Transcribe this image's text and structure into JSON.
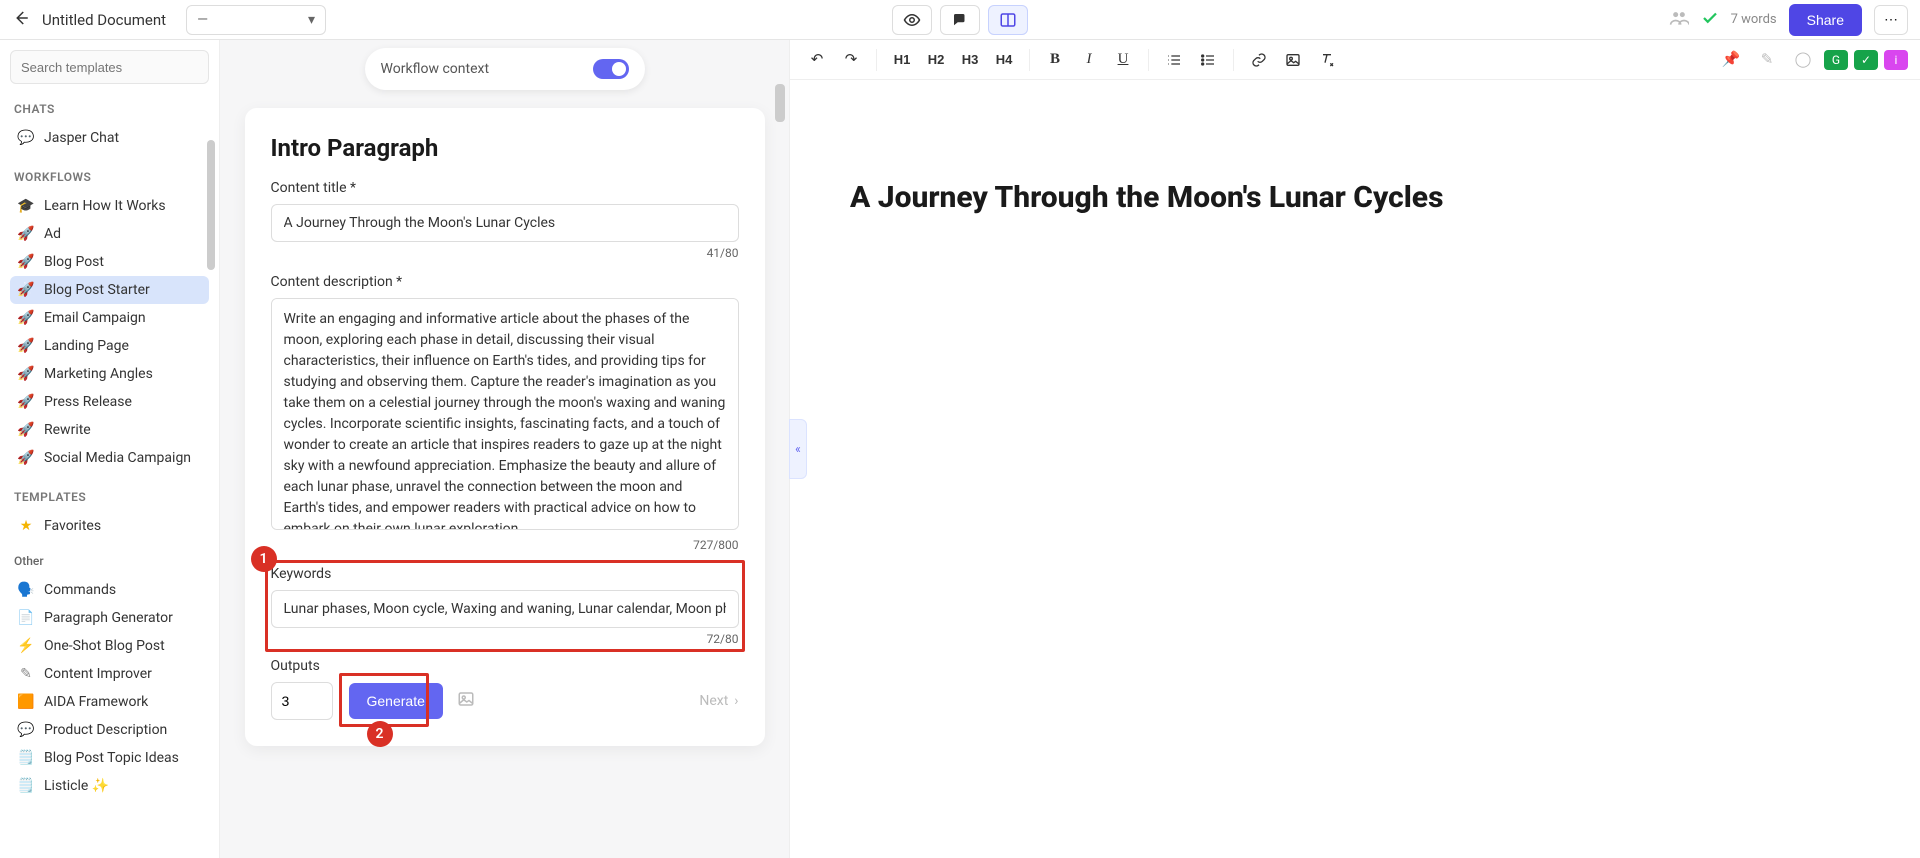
{
  "topbar": {
    "doc_title": "Untitled Document",
    "mode_placeholder": "—",
    "word_count": "7 words",
    "share_label": "Share"
  },
  "sidebar": {
    "search_placeholder": "Search templates",
    "sections": {
      "chats": "CHATS",
      "workflows": "WORKFLOWS",
      "templates": "TEMPLATES",
      "other": "Other"
    },
    "chats": [
      {
        "label": "Jasper Chat"
      }
    ],
    "workflows": [
      {
        "label": "Learn How It Works",
        "icon": "cap"
      },
      {
        "label": "Ad",
        "icon": "rocket"
      },
      {
        "label": "Blog Post",
        "icon": "rocket"
      },
      {
        "label": "Blog Post Starter",
        "icon": "rocket",
        "active": true
      },
      {
        "label": "Email Campaign",
        "icon": "rocket"
      },
      {
        "label": "Landing Page",
        "icon": "rocket"
      },
      {
        "label": "Marketing Angles",
        "icon": "rocket"
      },
      {
        "label": "Press Release",
        "icon": "rocket"
      },
      {
        "label": "Rewrite",
        "icon": "rocket"
      },
      {
        "label": "Social Media Campaign",
        "icon": "rocket"
      }
    ],
    "favorites_label": "Favorites",
    "templates": [
      {
        "label": "Commands",
        "icon": "blue"
      },
      {
        "label": "Paragraph Generator",
        "icon": "bolt"
      },
      {
        "label": "One-Shot Blog Post",
        "icon": "bolt"
      },
      {
        "label": "Content Improver",
        "icon": "edit"
      },
      {
        "label": "AIDA Framework",
        "icon": "green"
      },
      {
        "label": "Product Description",
        "icon": "chat"
      },
      {
        "label": "Blog Post Topic Ideas",
        "icon": "blue"
      },
      {
        "label": "Listicle ✨",
        "icon": "blue"
      }
    ]
  },
  "panel": {
    "workflow_context_label": "Workflow context",
    "title": "Intro Paragraph",
    "content_title_label": "Content title *",
    "content_title_value": "A Journey Through the Moon's Lunar Cycles",
    "content_title_counter": "41/80",
    "content_desc_label": "Content description *",
    "content_desc_value": "Write an engaging and informative article about the phases of the moon, exploring each phase in detail, discussing their visual characteristics, their influence on Earth's tides, and providing tips for studying and observing them. Capture the reader's imagination as you take them on a celestial journey through the moon's waxing and waning cycles. Incorporate scientific insights, fascinating facts, and a touch of wonder to create an article that inspires readers to gaze up at the night sky with a newfound appreciation. Emphasize the beauty and allure of each lunar phase, unravel the connection between the moon and Earth's tides, and empower readers with practical advice on how to embark on their own lunar exploration.",
    "content_desc_counter": "727/800",
    "keywords_label": "Keywords",
    "keywords_value": "Lunar phases, Moon cycle, Waxing and waning, Lunar calendar, Moon phases",
    "keywords_counter": "72/80",
    "outputs_label": "Outputs",
    "outputs_value": "3",
    "generate_label": "Generate",
    "next_label": "Next"
  },
  "editor": {
    "heading_text": "A Journey Through the Moon's Lunar Cycles",
    "h_labels": [
      "H1",
      "H2",
      "H3",
      "H4"
    ]
  },
  "annotations": {
    "a1": "1",
    "a2": "2"
  }
}
